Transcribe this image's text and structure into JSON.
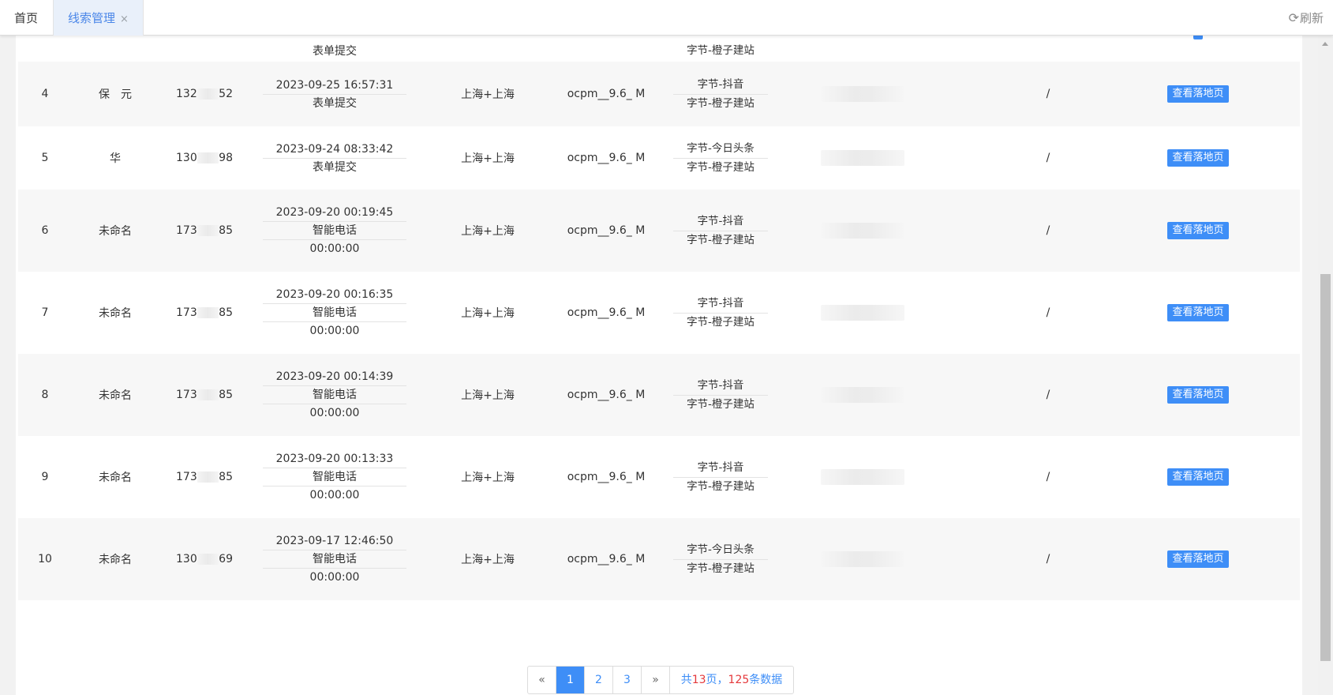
{
  "tabs": {
    "home": "首页",
    "active": "线索管理",
    "close_icon": "×",
    "refresh_label": "刷新",
    "refresh_icon": "⟳"
  },
  "partial_row": {
    "time_note": "表单提交",
    "source": "字节-橙子建站"
  },
  "op_button": "查看落地页",
  "rows": [
    {
      "no": "4",
      "name": "保　元",
      "phone_start": "132",
      "phone_end": "52",
      "time": "2023-09-25 16:57:31",
      "method": "表单提交",
      "duration": "",
      "area": "上海+上海",
      "plan": "ocpm__9.6_ M",
      "source1": "字节-抖音",
      "source2": "字节-橙子建站",
      "remark": "/"
    },
    {
      "no": "5",
      "name": "华",
      "phone_start": "130",
      "phone_end": "98",
      "time": "2023-09-24 08:33:42",
      "method": "表单提交",
      "duration": "",
      "area": "上海+上海",
      "plan": "ocpm__9.6_ M",
      "source1": "字节-今日头条",
      "source2": "字节-橙子建站",
      "remark": "/"
    },
    {
      "no": "6",
      "name": "未命名",
      "phone_start": "173",
      "phone_end": "85",
      "time": "2023-09-20 00:19:45",
      "method": "智能电话",
      "duration": "00:00:00",
      "area": "上海+上海",
      "plan": "ocpm__9.6_ M",
      "source1": "字节-抖音",
      "source2": "字节-橙子建站",
      "remark": "/"
    },
    {
      "no": "7",
      "name": "未命名",
      "phone_start": "173",
      "phone_end": "85",
      "time": "2023-09-20 00:16:35",
      "method": "智能电话",
      "duration": "00:00:00",
      "area": "上海+上海",
      "plan": "ocpm__9.6_ M",
      "source1": "字节-抖音",
      "source2": "字节-橙子建站",
      "remark": "/"
    },
    {
      "no": "8",
      "name": "未命名",
      "phone_start": "173",
      "phone_end": "85",
      "time": "2023-09-20 00:14:39",
      "method": "智能电话",
      "duration": "00:00:00",
      "area": "上海+上海",
      "plan": "ocpm__9.6_ M",
      "source1": "字节-抖音",
      "source2": "字节-橙子建站",
      "remark": "/"
    },
    {
      "no": "9",
      "name": "未命名",
      "phone_start": "173",
      "phone_end": "85",
      "time": "2023-09-20 00:13:33",
      "method": "智能电话",
      "duration": "00:00:00",
      "area": "上海+上海",
      "plan": "ocpm__9.6_ M",
      "source1": "字节-抖音",
      "source2": "字节-橙子建站",
      "remark": "/"
    },
    {
      "no": "10",
      "name": "未命名",
      "phone_start": "130",
      "phone_end": "69",
      "time": "2023-09-17 12:46:50",
      "method": "智能电话",
      "duration": "00:00:00",
      "area": "上海+上海",
      "plan": "ocpm__9.6_ M",
      "source1": "字节-今日头条",
      "source2": "字节-橙子建站",
      "remark": "/"
    }
  ],
  "pagination": {
    "prev": "«",
    "next": "»",
    "pages": [
      "1",
      "2",
      "3"
    ],
    "current": "1",
    "info_prefix": "共",
    "total_pages": "13",
    "info_mid": "页，",
    "total_records": "125",
    "info_suffix": "条数据"
  }
}
